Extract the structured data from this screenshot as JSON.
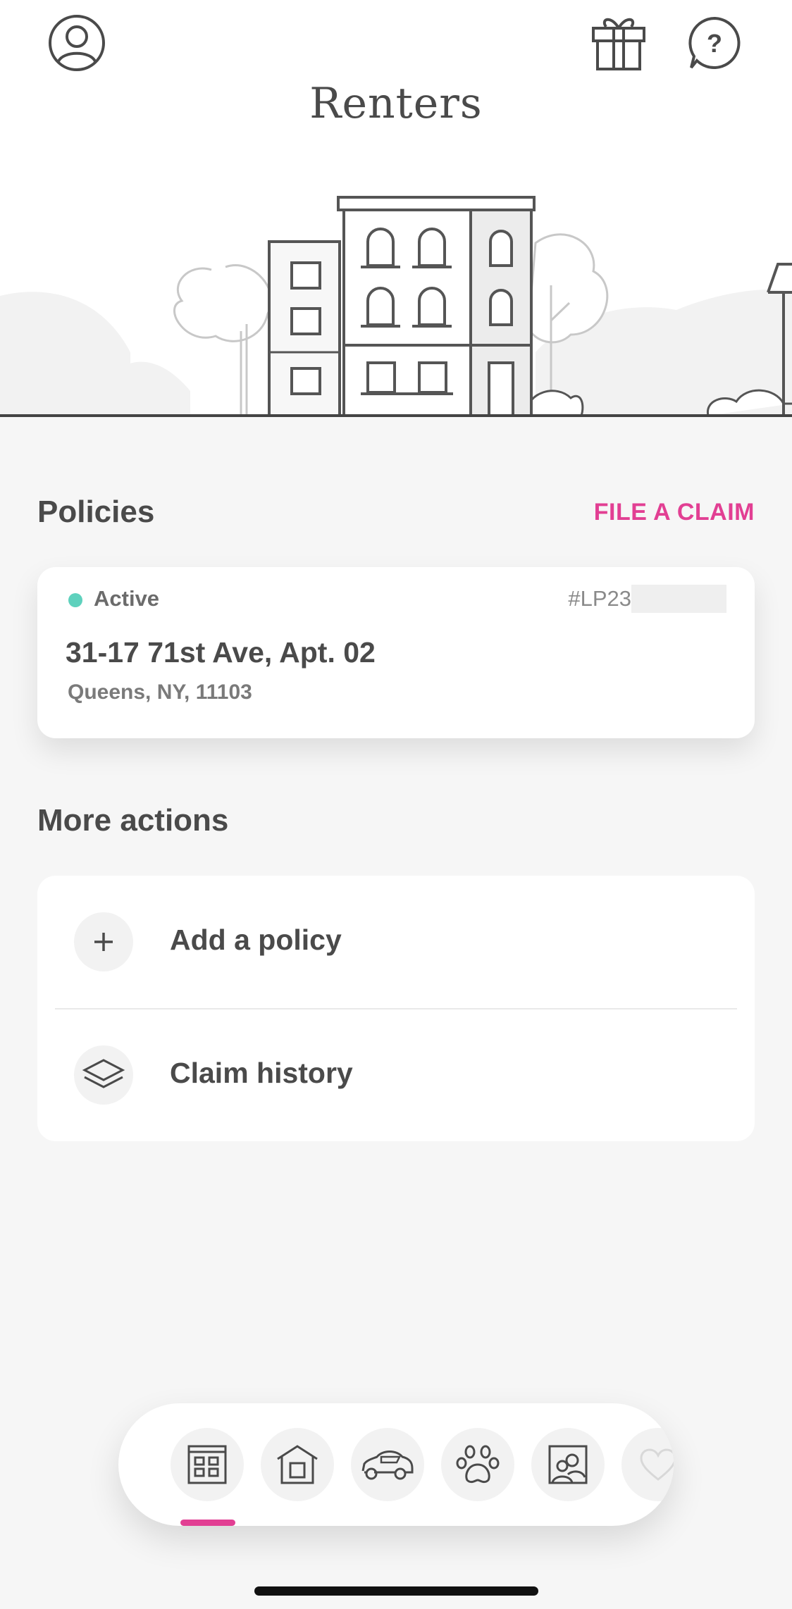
{
  "header": {
    "title": "Renters",
    "icons": [
      "profile-icon",
      "gift-icon",
      "help-icon"
    ]
  },
  "policies": {
    "title": "Policies",
    "action": "FILE A CLAIM",
    "card": {
      "status": "Active",
      "policy_number": "#LP23",
      "address": "31-17 71st Ave, Apt. 02",
      "city": "Queens, NY, 11103"
    }
  },
  "more_actions": {
    "title": "More actions",
    "items": [
      {
        "label": "Add a policy",
        "icon": "plus-icon"
      },
      {
        "label": "Claim history",
        "icon": "layers-icon"
      }
    ]
  },
  "tab_bar": {
    "tabs": [
      {
        "name": "renters",
        "icon": "building-icon",
        "selected": true
      },
      {
        "name": "home",
        "icon": "house-icon"
      },
      {
        "name": "car",
        "icon": "car-icon"
      },
      {
        "name": "pet",
        "icon": "paw-icon"
      },
      {
        "name": "life",
        "icon": "portrait-icon"
      },
      {
        "name": "more",
        "icon": "heart-icon"
      }
    ]
  },
  "colors": {
    "accent": "#e23f93",
    "active_status": "#5ed1bd",
    "text_primary": "#4a4a4a",
    "background": "#f6f6f6"
  }
}
